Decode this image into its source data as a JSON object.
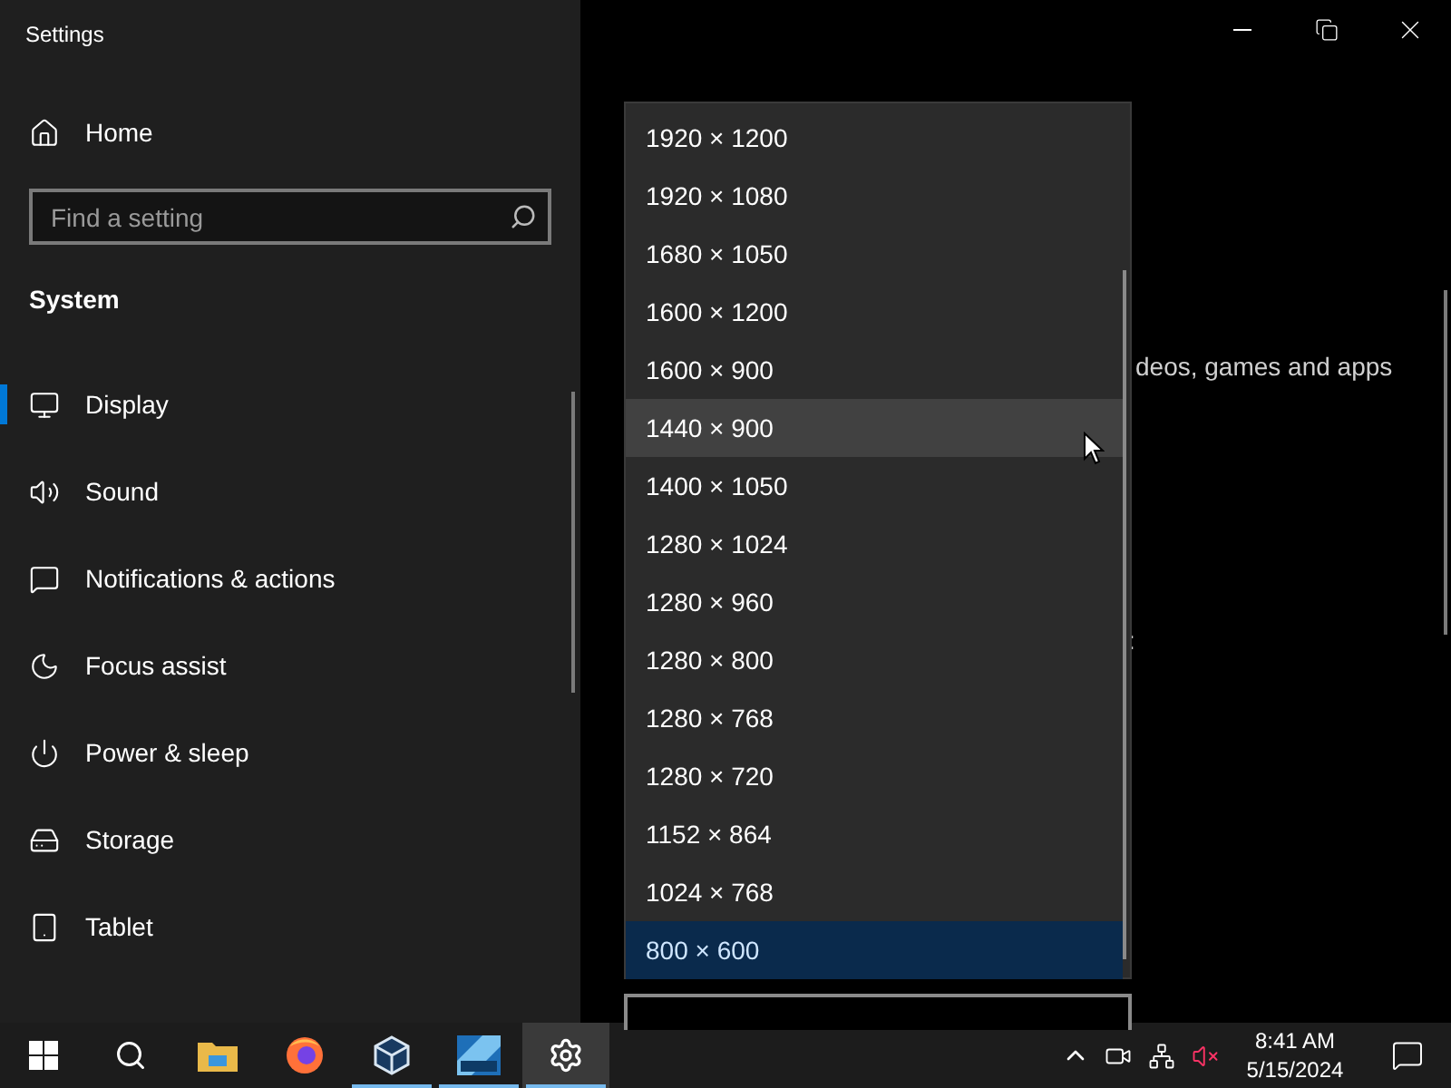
{
  "window": {
    "title": "Settings"
  },
  "sidebar": {
    "home": "Home",
    "search": {
      "placeholder": "Find a setting"
    },
    "section": "System",
    "items": [
      {
        "label": "Display",
        "selected": true
      },
      {
        "label": "Sound",
        "selected": false
      },
      {
        "label": "Notifications & actions",
        "selected": false
      },
      {
        "label": "Focus assist",
        "selected": false
      },
      {
        "label": "Power & sleep",
        "selected": false
      },
      {
        "label": "Storage",
        "selected": false
      },
      {
        "label": "Tablet",
        "selected": false
      }
    ]
  },
  "content": {
    "text_1": "deos, games and apps",
    "text_2": ":"
  },
  "dropdown": {
    "options": [
      {
        "label": "1920 × 1200",
        "selected": false,
        "hovered": false
      },
      {
        "label": "1920 × 1080",
        "selected": false,
        "hovered": false
      },
      {
        "label": "1680 × 1050",
        "selected": false,
        "hovered": false
      },
      {
        "label": "1600 × 1200",
        "selected": false,
        "hovered": false
      },
      {
        "label": "1600 × 900",
        "selected": false,
        "hovered": false
      },
      {
        "label": "1440 × 900",
        "selected": false,
        "hovered": true
      },
      {
        "label": "1400 × 1050",
        "selected": false,
        "hovered": false
      },
      {
        "label": "1280 × 1024",
        "selected": false,
        "hovered": false
      },
      {
        "label": "1280 × 960",
        "selected": false,
        "hovered": false
      },
      {
        "label": "1280 × 800",
        "selected": false,
        "hovered": false
      },
      {
        "label": "1280 × 768",
        "selected": false,
        "hovered": false
      },
      {
        "label": "1280 × 720",
        "selected": false,
        "hovered": false
      },
      {
        "label": "1152 × 864",
        "selected": false,
        "hovered": false
      },
      {
        "label": "1024 × 768",
        "selected": false,
        "hovered": false
      },
      {
        "label": "800 × 600",
        "selected": true,
        "hovered": false
      }
    ]
  },
  "taskbar": {
    "apps": [
      {
        "kind": "start",
        "running": false,
        "selected": false
      },
      {
        "kind": "search",
        "running": false,
        "selected": false
      },
      {
        "kind": "explorer",
        "running": false,
        "selected": false
      },
      {
        "kind": "firefox",
        "running": false,
        "selected": false
      },
      {
        "kind": "cube",
        "running": true,
        "selected": false
      },
      {
        "kind": "server",
        "running": true,
        "selected": false
      },
      {
        "kind": "settings",
        "running": true,
        "selected": true
      }
    ],
    "time": "8:41 AM",
    "date": "5/15/2024",
    "volume_muted": true
  }
}
